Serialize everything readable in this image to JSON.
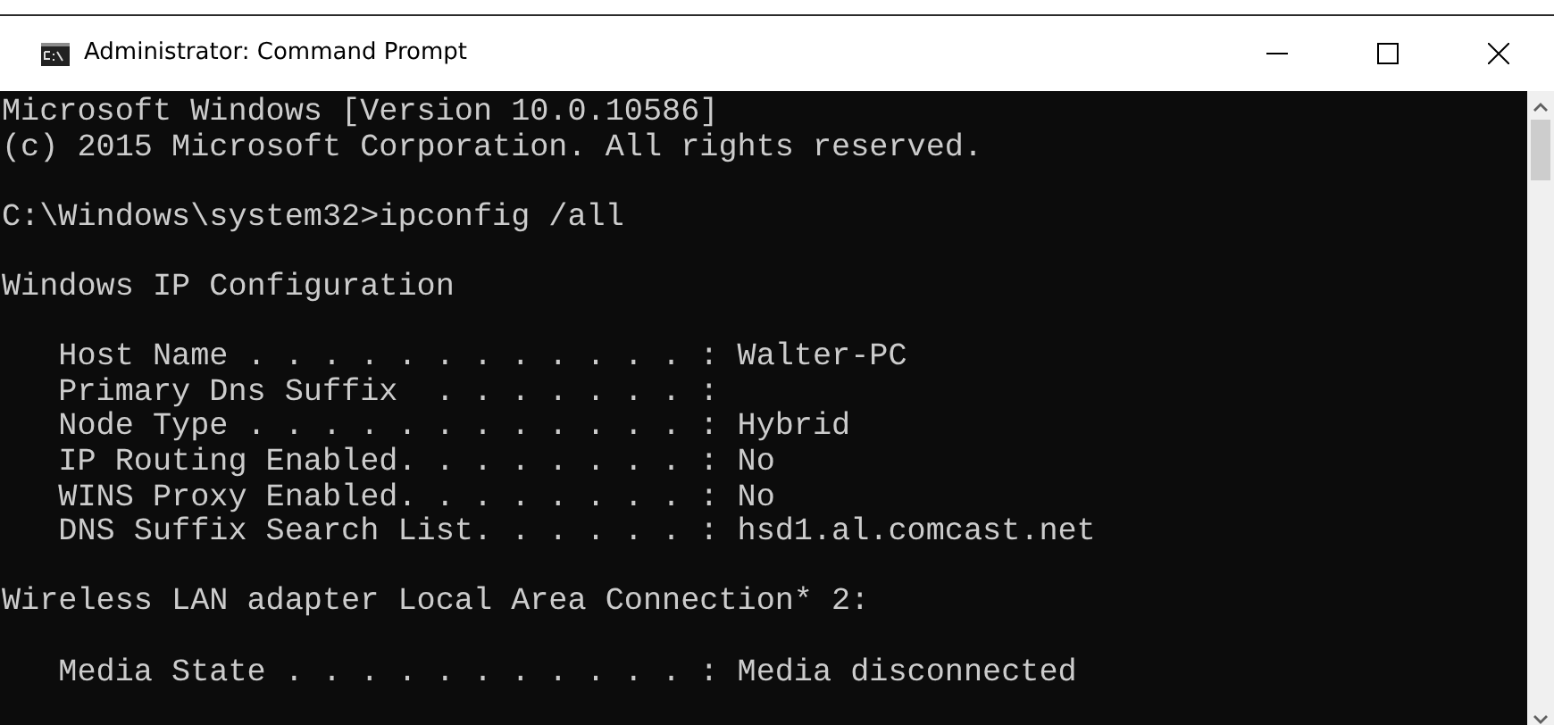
{
  "window": {
    "title": "Administrator: Command Prompt"
  },
  "console": {
    "lines": [
      {
        "kind": "text",
        "text": "Microsoft Windows [Version 10.0.10586]"
      },
      {
        "kind": "text",
        "text": "(c) 2015 Microsoft Corporation. All rights reserved."
      },
      {
        "kind": "blank"
      },
      {
        "kind": "text",
        "text": "C:\\Windows\\system32>ipconfig /all"
      },
      {
        "kind": "blank"
      },
      {
        "kind": "text",
        "text": "Windows IP Configuration"
      },
      {
        "kind": "blank"
      },
      {
        "kind": "text",
        "text": "   Host Name . . . . . . . . . . . . : Walter-PC"
      },
      {
        "kind": "text",
        "text": "   Primary Dns Suffix  . . . . . . . :"
      },
      {
        "kind": "text",
        "text": "   Node Type . . . . . . . . . . . . : Hybrid"
      },
      {
        "kind": "text",
        "text": "   IP Routing Enabled. . . . . . . . : No"
      },
      {
        "kind": "text",
        "text": "   WINS Proxy Enabled. . . . . . . . : No"
      },
      {
        "kind": "text",
        "text": "   DNS Suffix Search List. . . . . . : hsd1.al.comcast.net"
      },
      {
        "kind": "blank"
      },
      {
        "kind": "text",
        "text": "Wireless LAN adapter Local Area Connection* 2:"
      },
      {
        "kind": "blank"
      },
      {
        "kind": "text",
        "text": "   Media State . . . . . . . . . . . : Media disconnected"
      }
    ]
  }
}
